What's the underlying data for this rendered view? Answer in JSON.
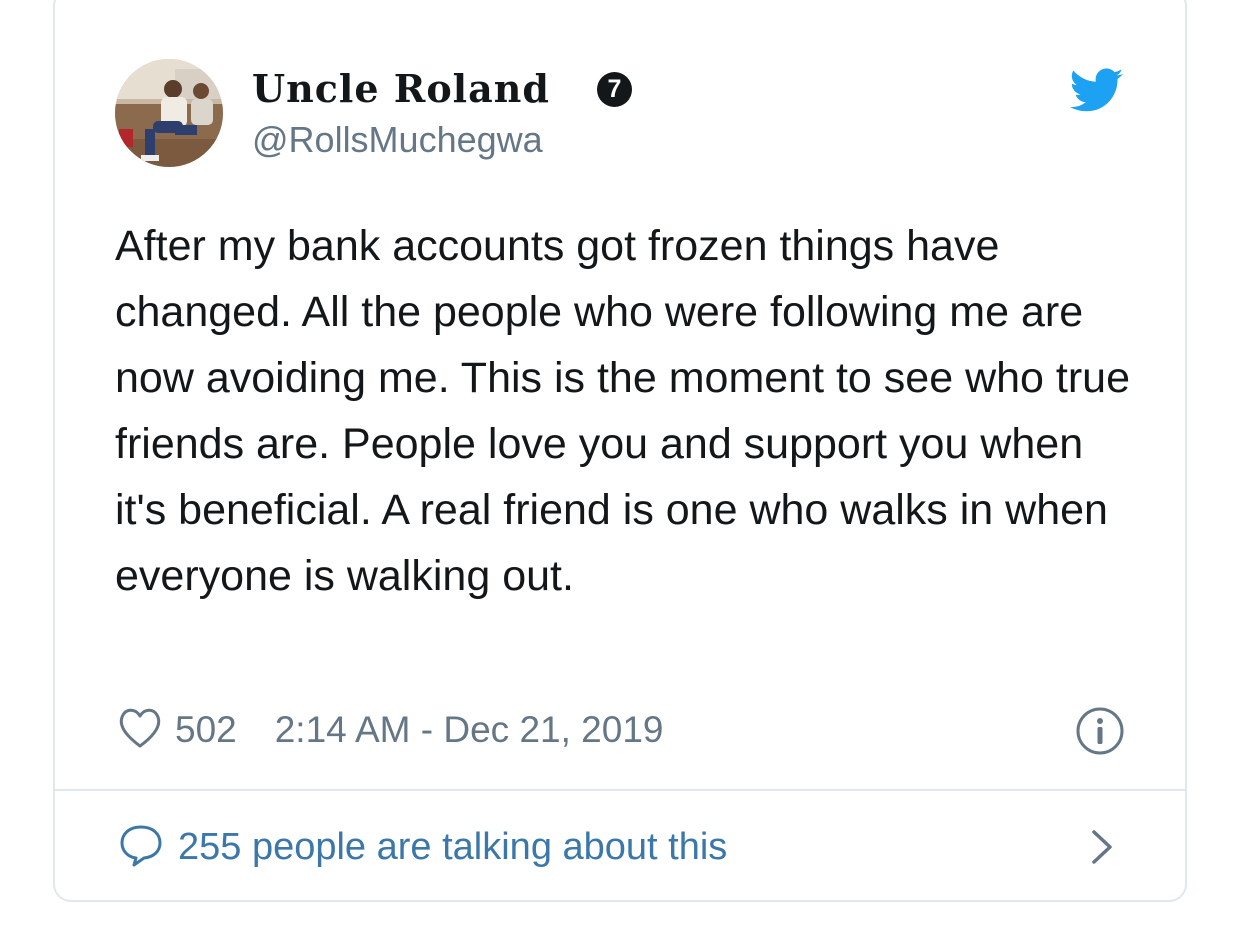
{
  "tweet": {
    "display_name": "Uncle Roland",
    "name_emoji": "7",
    "handle": "@RollsMuchegwa",
    "text": "After my bank accounts got frozen things have changed. All the people who were following me are now avoiding me. This is the moment to see who true friends are. People love you and support you when it's beneficial. A real friend is one who walks in when everyone is walking out.",
    "like_count": "502",
    "timestamp": "2:14 AM - Dec 21, 2019",
    "conversation_label": "255 people are talking about this"
  },
  "icons": {
    "brand": "twitter-bird-icon",
    "like": "heart-icon",
    "info": "info-icon",
    "conversation": "speech-bubble-icon",
    "open": "chevron-right-icon"
  },
  "colors": {
    "text": "#14171a",
    "secondary": "#657786",
    "link": "#3b77a8",
    "twitter_blue": "#1da1f2",
    "border": "#e1e8ed"
  }
}
